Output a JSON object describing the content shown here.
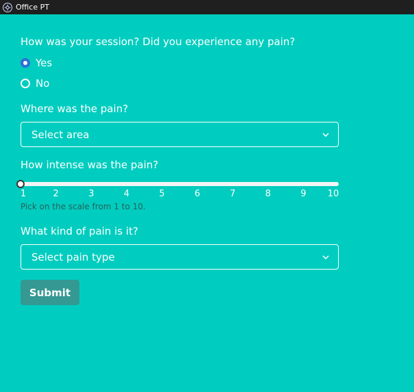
{
  "window": {
    "title": "Office PT",
    "icon": "app-logo-icon"
  },
  "form": {
    "q1": {
      "label": "How was your session? Did you experience any pain?",
      "options": [
        {
          "label": "Yes",
          "checked": true
        },
        {
          "label": "No",
          "checked": false
        }
      ]
    },
    "q2": {
      "label": "Where was the pain?",
      "placeholder": "Select area"
    },
    "q3": {
      "label": "How intense was the pain?",
      "scale": {
        "min": 1,
        "max": 10,
        "value": 1,
        "ticks": [
          "1",
          "2",
          "3",
          "4",
          "5",
          "6",
          "7",
          "8",
          "9",
          "10"
        ],
        "helper": "Pick on the scale from 1 to 10."
      }
    },
    "q4": {
      "label": "What kind of pain is it?",
      "placeholder": "Select pain type"
    },
    "submit_label": "Submit"
  },
  "colors": {
    "background": "#00cdbf",
    "titlebar": "#1f1f1f",
    "radio_checked": "#2e6fd6",
    "button": "#349992",
    "helper_text": "#2b5f5a"
  }
}
